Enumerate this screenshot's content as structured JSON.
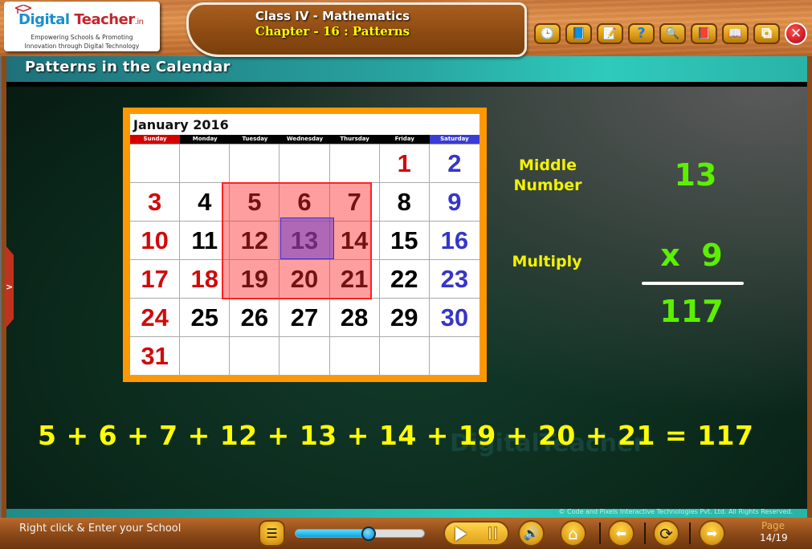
{
  "header": {
    "logo": {
      "brand_part1": "Digital",
      "brand_part2": "Teacher",
      "brand_suffix": ".in",
      "tagline_line1": "Empowering Schools & Promoting",
      "tagline_line2": "Innovation through Digital Technology"
    },
    "class_title": "Class IV - Mathematics",
    "chapter_title": "Chapter - 16 : Patterns",
    "toolbar": [
      {
        "name": "clock-folder",
        "icon": "🕒"
      },
      {
        "name": "reference-book",
        "icon": "📘"
      },
      {
        "name": "notepad",
        "icon": "📝"
      },
      {
        "name": "help",
        "icon": "?"
      },
      {
        "name": "search",
        "icon": "🔍"
      },
      {
        "name": "dictionary",
        "icon": "📕"
      },
      {
        "name": "open-book",
        "icon": "📖"
      },
      {
        "name": "window-resize",
        "icon": "⧉"
      },
      {
        "name": "close",
        "icon": "✕"
      }
    ]
  },
  "section_title": "Patterns in the Calendar",
  "side_tab_icon": ">",
  "calendar": {
    "month_title": "January 2016",
    "weekdays": [
      "Sunday",
      "Monday",
      "Tuesday",
      "Wednesday",
      "Thursday",
      "Friday",
      "Saturday"
    ],
    "cells": [
      {
        "v": "",
        "c": "black"
      },
      {
        "v": "",
        "c": "black"
      },
      {
        "v": "",
        "c": "black"
      },
      {
        "v": "",
        "c": "black"
      },
      {
        "v": "",
        "c": "black"
      },
      {
        "v": "1",
        "c": "red"
      },
      {
        "v": "2",
        "c": "blue"
      },
      {
        "v": "3",
        "c": "red"
      },
      {
        "v": "4",
        "c": "black"
      },
      {
        "v": "5",
        "c": "black"
      },
      {
        "v": "6",
        "c": "black"
      },
      {
        "v": "7",
        "c": "black"
      },
      {
        "v": "8",
        "c": "black"
      },
      {
        "v": "9",
        "c": "blue"
      },
      {
        "v": "10",
        "c": "red"
      },
      {
        "v": "11",
        "c": "black"
      },
      {
        "v": "12",
        "c": "black"
      },
      {
        "v": "13",
        "c": "black"
      },
      {
        "v": "14",
        "c": "black"
      },
      {
        "v": "15",
        "c": "black"
      },
      {
        "v": "16",
        "c": "blue"
      },
      {
        "v": "17",
        "c": "red"
      },
      {
        "v": "18",
        "c": "red"
      },
      {
        "v": "19",
        "c": "black"
      },
      {
        "v": "20",
        "c": "black"
      },
      {
        "v": "21",
        "c": "black"
      },
      {
        "v": "22",
        "c": "black"
      },
      {
        "v": "23",
        "c": "blue"
      },
      {
        "v": "24",
        "c": "red"
      },
      {
        "v": "25",
        "c": "black"
      },
      {
        "v": "26",
        "c": "black"
      },
      {
        "v": "27",
        "c": "black"
      },
      {
        "v": "28",
        "c": "black"
      },
      {
        "v": "29",
        "c": "black"
      },
      {
        "v": "30",
        "c": "blue"
      },
      {
        "v": "31",
        "c": "red"
      },
      {
        "v": "",
        "c": "black"
      },
      {
        "v": "",
        "c": "black"
      },
      {
        "v": "",
        "c": "black"
      },
      {
        "v": "",
        "c": "black"
      },
      {
        "v": "",
        "c": "black"
      },
      {
        "v": "",
        "c": "black"
      }
    ],
    "highlighted_block": [
      "5",
      "6",
      "7",
      "12",
      "13",
      "14",
      "19",
      "20",
      "21"
    ],
    "middle_number": "13"
  },
  "explanation": {
    "middle_label_line1": "Middle",
    "middle_label_line2": "Number",
    "middle_value": "13",
    "multiply_label": "Multiply",
    "multiplier": "x  9",
    "result": "117"
  },
  "equation": "5 + 6 + 7 + 12 + 13 + 14 + 19 + 20 + 21 = 117",
  "watermark": "DigitalTeacher",
  "footer": {
    "copyright": "© Code and Pixels Interactive Technologies  Pvt. Ltd. All Rights Reserved.",
    "school_prompt": "Right click & Enter your School",
    "progress_fraction": 0.57,
    "page_label": "Page",
    "page_number": "14/19",
    "icons": {
      "menu": "☰",
      "volume": "🔊",
      "home": "⌂",
      "back": "⬅",
      "replay": "⟳",
      "next": "➡"
    }
  },
  "colors": {
    "accent_orange": "#ff9800",
    "highlight_red": "#ff2222",
    "middle_purple": "#6e3cc8",
    "label_yellow": "#f2f200",
    "number_green": "#5cf000"
  }
}
